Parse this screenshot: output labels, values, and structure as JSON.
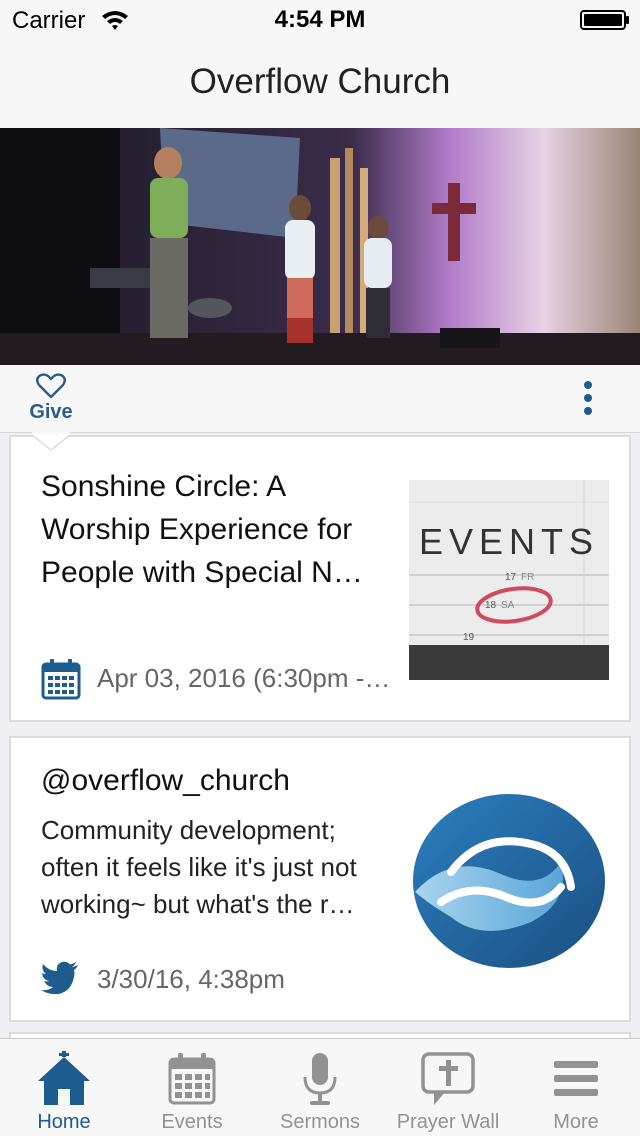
{
  "status_bar": {
    "carrier": "Carrier",
    "time": "4:54 PM"
  },
  "nav": {
    "title": "Overflow Church"
  },
  "action_bar": {
    "give_label": "Give"
  },
  "feed": [
    {
      "type": "event",
      "title": "Sonshine Circle: A Worship Experience for People with Special N…",
      "date": "Apr 03, 2016 (6:30pm -…",
      "thumb_text": "EVENTS",
      "thumb_days": [
        "17",
        "FR",
        "18",
        "SA",
        "19"
      ]
    },
    {
      "type": "tweet",
      "handle": "@overflow_church",
      "body": "Community development; often it feels like it's just not working~ but what's the r…",
      "time": "3/30/16, 4:38pm"
    }
  ],
  "tabs": [
    {
      "label": "Home",
      "icon": "home-icon",
      "active": true
    },
    {
      "label": "Events",
      "icon": "calendar-icon",
      "active": false
    },
    {
      "label": "Sermons",
      "icon": "microphone-icon",
      "active": false
    },
    {
      "label": "Prayer Wall",
      "icon": "prayer-bubble-icon",
      "active": false
    },
    {
      "label": "More",
      "icon": "menu-icon",
      "active": false
    }
  ],
  "colors": {
    "accent": "#1e5b8e",
    "inactive": "#929292",
    "give": "#2c5c8f"
  }
}
